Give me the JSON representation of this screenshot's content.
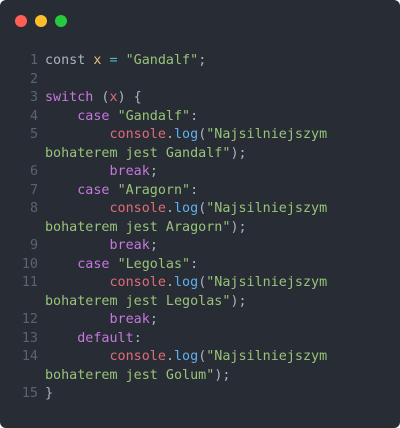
{
  "window": {
    "background": "#282c34",
    "controls": [
      {
        "name": "close",
        "color": "#ff5f56"
      },
      {
        "name": "minimize",
        "color": "#ffbd2e"
      },
      {
        "name": "maximize",
        "color": "#27c93f"
      }
    ]
  },
  "code": {
    "lines": [
      {
        "num": "1",
        "parts": [
          {
            "t": "const",
            "c": "pl"
          },
          {
            "t": " ",
            "c": "pl"
          },
          {
            "t": "x",
            "c": "var"
          },
          {
            "t": " ",
            "c": "pl"
          },
          {
            "t": "=",
            "c": "op"
          },
          {
            "t": " ",
            "c": "pl"
          },
          {
            "t": "\"Gandalf\"",
            "c": "str"
          },
          {
            "t": ";",
            "c": "pl"
          }
        ]
      },
      {
        "num": "2",
        "parts": []
      },
      {
        "num": "3",
        "parts": [
          {
            "t": "switch",
            "c": "kw"
          },
          {
            "t": " (",
            "c": "pl"
          },
          {
            "t": "x",
            "c": "obj"
          },
          {
            "t": ") {",
            "c": "pl"
          }
        ]
      },
      {
        "num": "4",
        "parts": [
          {
            "t": "    ",
            "c": "pl"
          },
          {
            "t": "case",
            "c": "kw"
          },
          {
            "t": " ",
            "c": "pl"
          },
          {
            "t": "\"Gandalf\"",
            "c": "str"
          },
          {
            "t": ":",
            "c": "pl"
          }
        ]
      },
      {
        "num": "5",
        "parts": [
          {
            "t": "        ",
            "c": "pl"
          },
          {
            "t": "console",
            "c": "obj"
          },
          {
            "t": ".",
            "c": "pl"
          },
          {
            "t": "log",
            "c": "fn"
          },
          {
            "t": "(",
            "c": "pl"
          },
          {
            "t": "\"Najsilniejszym",
            "c": "str"
          }
        ]
      },
      {
        "num": "",
        "parts": [
          {
            "t": "bohaterem jest Gandalf\"",
            "c": "str"
          },
          {
            "t": ");",
            "c": "pl"
          }
        ]
      },
      {
        "num": "6",
        "parts": [
          {
            "t": "        ",
            "c": "pl"
          },
          {
            "t": "break",
            "c": "kw"
          },
          {
            "t": ";",
            "c": "pl"
          }
        ]
      },
      {
        "num": "7",
        "parts": [
          {
            "t": "    ",
            "c": "pl"
          },
          {
            "t": "case",
            "c": "kw"
          },
          {
            "t": " ",
            "c": "pl"
          },
          {
            "t": "\"Aragorn\"",
            "c": "str"
          },
          {
            "t": ":",
            "c": "pl"
          }
        ]
      },
      {
        "num": "8",
        "parts": [
          {
            "t": "        ",
            "c": "pl"
          },
          {
            "t": "console",
            "c": "obj"
          },
          {
            "t": ".",
            "c": "pl"
          },
          {
            "t": "log",
            "c": "fn"
          },
          {
            "t": "(",
            "c": "pl"
          },
          {
            "t": "\"Najsilniejszym",
            "c": "str"
          }
        ]
      },
      {
        "num": "",
        "parts": [
          {
            "t": "bohaterem jest Aragorn\"",
            "c": "str"
          },
          {
            "t": ");",
            "c": "pl"
          }
        ]
      },
      {
        "num": "9",
        "parts": [
          {
            "t": "        ",
            "c": "pl"
          },
          {
            "t": "break",
            "c": "kw"
          },
          {
            "t": ";",
            "c": "pl"
          }
        ]
      },
      {
        "num": "10",
        "parts": [
          {
            "t": "    ",
            "c": "pl"
          },
          {
            "t": "case",
            "c": "kw"
          },
          {
            "t": " ",
            "c": "pl"
          },
          {
            "t": "\"Legolas\"",
            "c": "str"
          },
          {
            "t": ":",
            "c": "pl"
          }
        ]
      },
      {
        "num": "11",
        "parts": [
          {
            "t": "        ",
            "c": "pl"
          },
          {
            "t": "console",
            "c": "obj"
          },
          {
            "t": ".",
            "c": "pl"
          },
          {
            "t": "log",
            "c": "fn"
          },
          {
            "t": "(",
            "c": "pl"
          },
          {
            "t": "\"Najsilniejszym",
            "c": "str"
          }
        ]
      },
      {
        "num": "",
        "parts": [
          {
            "t": "bohaterem jest Legolas\"",
            "c": "str"
          },
          {
            "t": ");",
            "c": "pl"
          }
        ]
      },
      {
        "num": "12",
        "parts": [
          {
            "t": "        ",
            "c": "pl"
          },
          {
            "t": "break",
            "c": "kw"
          },
          {
            "t": ";",
            "c": "pl"
          }
        ]
      },
      {
        "num": "13",
        "parts": [
          {
            "t": "    ",
            "c": "pl"
          },
          {
            "t": "default",
            "c": "kw"
          },
          {
            "t": ":",
            "c": "pl"
          }
        ]
      },
      {
        "num": "14",
        "parts": [
          {
            "t": "        ",
            "c": "pl"
          },
          {
            "t": "console",
            "c": "obj"
          },
          {
            "t": ".",
            "c": "pl"
          },
          {
            "t": "log",
            "c": "fn"
          },
          {
            "t": "(",
            "c": "pl"
          },
          {
            "t": "\"Najsilniejszym",
            "c": "str"
          }
        ]
      },
      {
        "num": "",
        "parts": [
          {
            "t": "bohaterem jest Golum\"",
            "c": "str"
          },
          {
            "t": ");",
            "c": "pl"
          }
        ]
      },
      {
        "num": "15",
        "parts": [
          {
            "t": "}",
            "c": "pl"
          }
        ]
      }
    ]
  }
}
